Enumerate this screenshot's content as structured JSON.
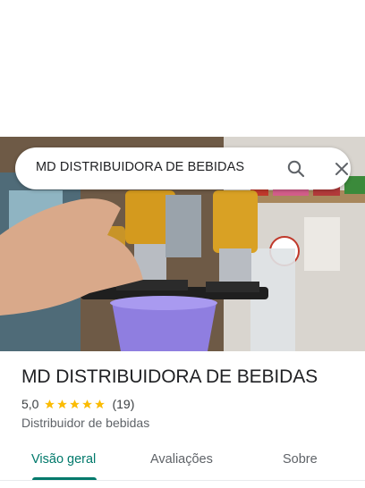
{
  "search": {
    "query": "MD DISTRIBUIDORA DE BEBIDAS",
    "search_icon": "search-icon",
    "close_icon": "close-icon"
  },
  "hero": {
    "image_subject": "bar bottle dispensers pouring into a purple cup"
  },
  "place": {
    "title": "MD DISTRIBUIDORA DE BEBIDAS",
    "rating": "5,0",
    "stars": 5,
    "review_count": "(19)",
    "category": "Distribuidor de bebidas"
  },
  "tabs": [
    {
      "label": "Visão geral",
      "active": true
    },
    {
      "label": "Avaliações",
      "active": false
    },
    {
      "label": "Sobre",
      "active": false
    }
  ],
  "colors": {
    "accent": "#00796b",
    "star": "#fbbc04",
    "text_primary": "#202124",
    "text_secondary": "#5f6368"
  }
}
